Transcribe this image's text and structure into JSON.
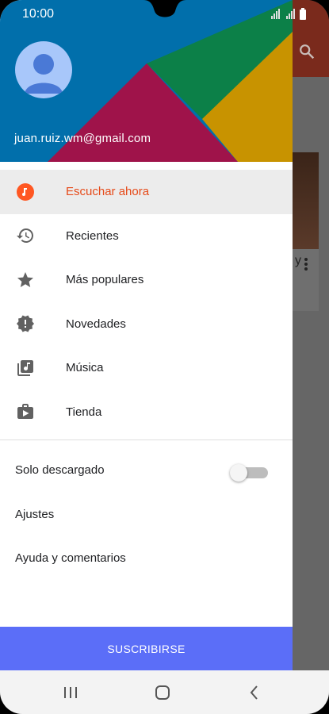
{
  "status_bar": {
    "time": "10:00"
  },
  "account": {
    "email": "juan.ruiz.wm@gmail.com"
  },
  "menu": {
    "items": [
      {
        "label": "Escuchar ahora",
        "icon": "listen-now-icon",
        "active": true
      },
      {
        "label": "Recientes",
        "icon": "history-icon",
        "active": false
      },
      {
        "label": "Más populares",
        "icon": "star-icon",
        "active": false
      },
      {
        "label": "Novedades",
        "icon": "new-releases-icon",
        "active": false
      },
      {
        "label": "Música",
        "icon": "music-library-icon",
        "active": false
      },
      {
        "label": "Tienda",
        "icon": "play-store-icon",
        "active": false
      }
    ]
  },
  "settings": {
    "downloaded_only": {
      "label": "Solo descargado",
      "toggle_on": false
    },
    "settings_label": "Ajustes",
    "help_label": "Ayuda y comentarios"
  },
  "subscribe": {
    "label": "SUSCRIBIRSE"
  },
  "colors": {
    "accent": "#e64a19",
    "subscribe_bg": "#5b6ef8",
    "header_blue": "#0288d1",
    "header_green": "#0f9d58",
    "header_yellow": "#f4b400",
    "header_red": "#c2185b"
  }
}
